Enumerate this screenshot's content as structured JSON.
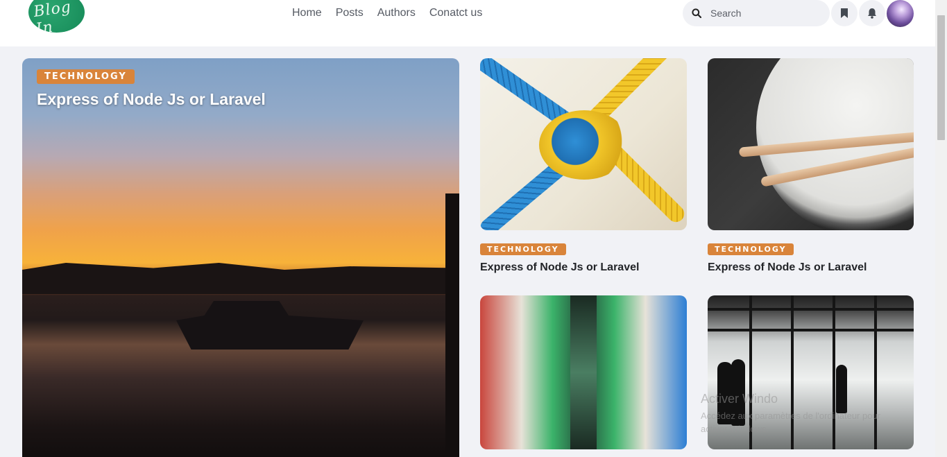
{
  "header": {
    "logo_text": "Blog In",
    "nav": [
      "Home",
      "Posts",
      "Authors",
      "Conatct us"
    ],
    "search_placeholder": "Search"
  },
  "hero": {
    "category": "TECHNOLOGY",
    "title": "Express of Node Js or Laravel"
  },
  "cards": [
    {
      "category": "TECHNOLOGY",
      "title": "Express of Node Js or Laravel"
    },
    {
      "category": "TECHNOLOGY",
      "title": "Express of Node Js or Laravel"
    }
  ],
  "watermark": {
    "line1": "Activer Windo",
    "line2": "Accédez aux paramètres de l'ordinateur pour activer Windows."
  },
  "colors": {
    "badge": "#d9843a",
    "page_bg": "#f1f2f6"
  }
}
